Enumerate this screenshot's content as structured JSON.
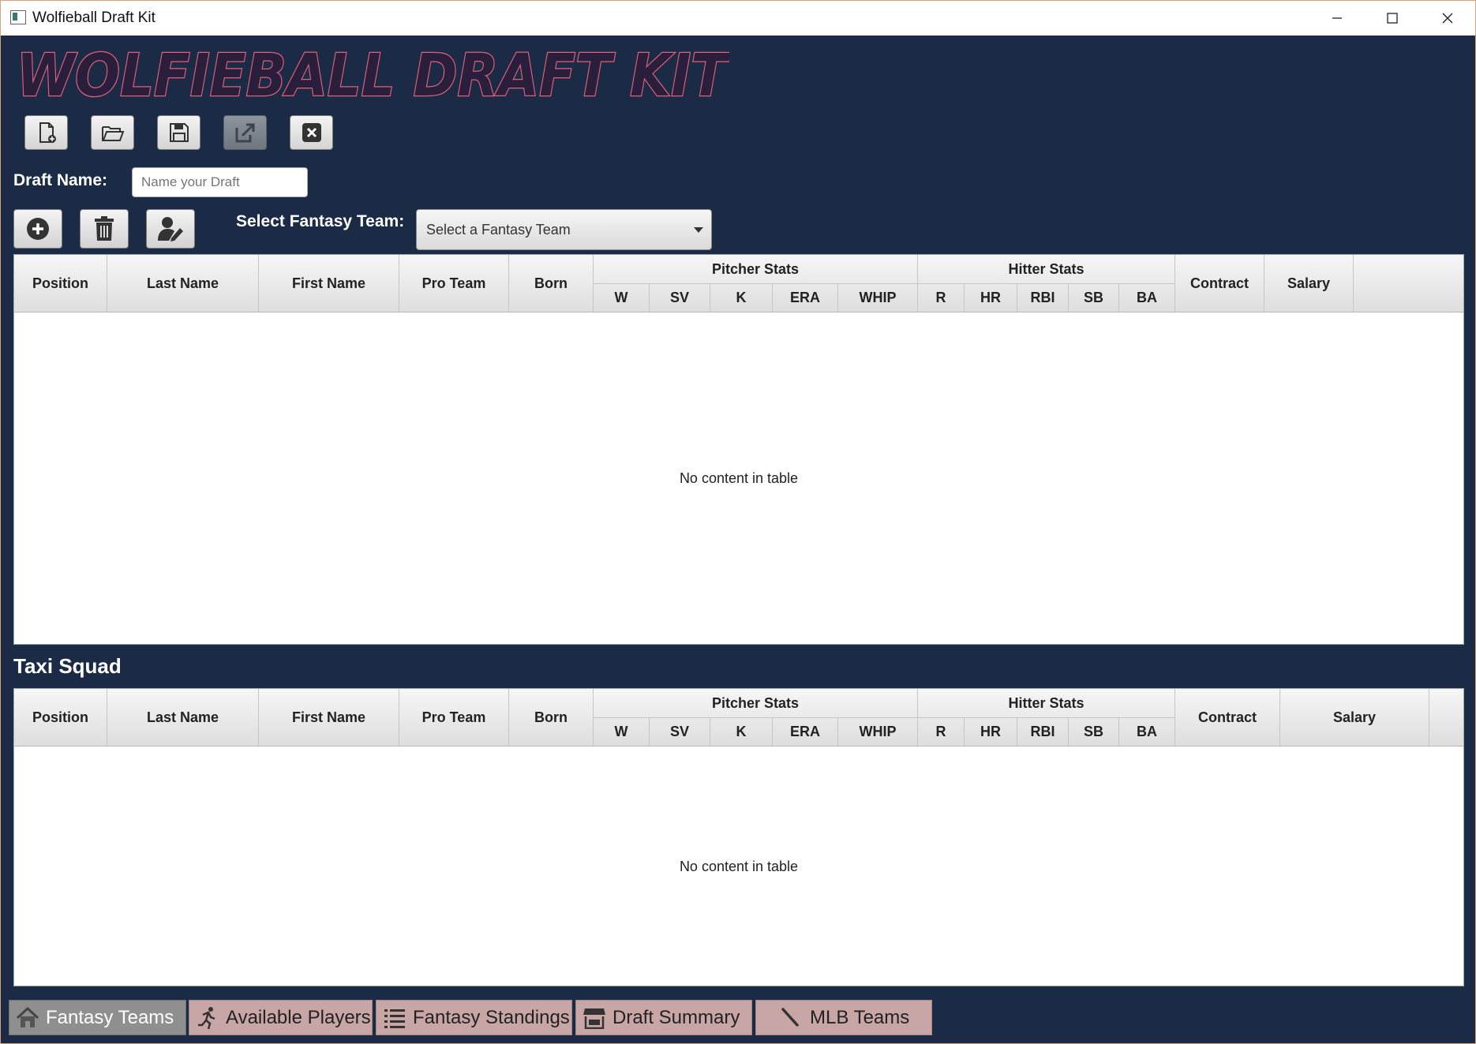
{
  "window": {
    "title": "Wolfieball Draft Kit"
  },
  "logo": {
    "text": "WOLFIEBALL DRAFT KIT"
  },
  "toolbar": {
    "new_label": "",
    "open_label": "",
    "save_label": "",
    "export_label": "",
    "exit_label": ""
  },
  "draft": {
    "label": "Draft Name:",
    "placeholder": "Name your Draft",
    "value": ""
  },
  "team_select": {
    "label": "Select Fantasy Team:",
    "selected": "Select a Fantasy Team"
  },
  "taxi_squad": {
    "title": "Taxi Squad"
  },
  "table": {
    "columns": {
      "position": "Position",
      "last_name": "Last Name",
      "first_name": "First Name",
      "pro_team": "Pro Team",
      "born": "Born",
      "pitcher_stats": "Pitcher Stats",
      "w": "W",
      "sv": "SV",
      "k": "K",
      "era": "ERA",
      "whip": "WHIP",
      "hitter_stats": "Hitter Stats",
      "r": "R",
      "hr": "HR",
      "rbi": "RBI",
      "sb": "SB",
      "ba": "BA",
      "contract": "Contract",
      "salary": "Salary"
    },
    "empty": "No content in table",
    "rows": []
  },
  "tabs": [
    {
      "label": "Fantasy Teams",
      "icon": "home-icon",
      "active": true
    },
    {
      "label": "Available Players",
      "icon": "runner-icon",
      "active": false
    },
    {
      "label": "Fantasy Standings",
      "icon": "list-icon",
      "active": false
    },
    {
      "label": "Draft Summary",
      "icon": "store-icon",
      "active": false
    },
    {
      "label": "MLB Teams",
      "icon": "bat-icon",
      "active": false
    }
  ],
  "colors": {
    "background": "#1c2b45",
    "tab_inactive": "#c8a6a6",
    "tab_active": "#8f8f8f",
    "logo_fill": "#2a1e3d",
    "logo_stroke": "#e0607a"
  }
}
